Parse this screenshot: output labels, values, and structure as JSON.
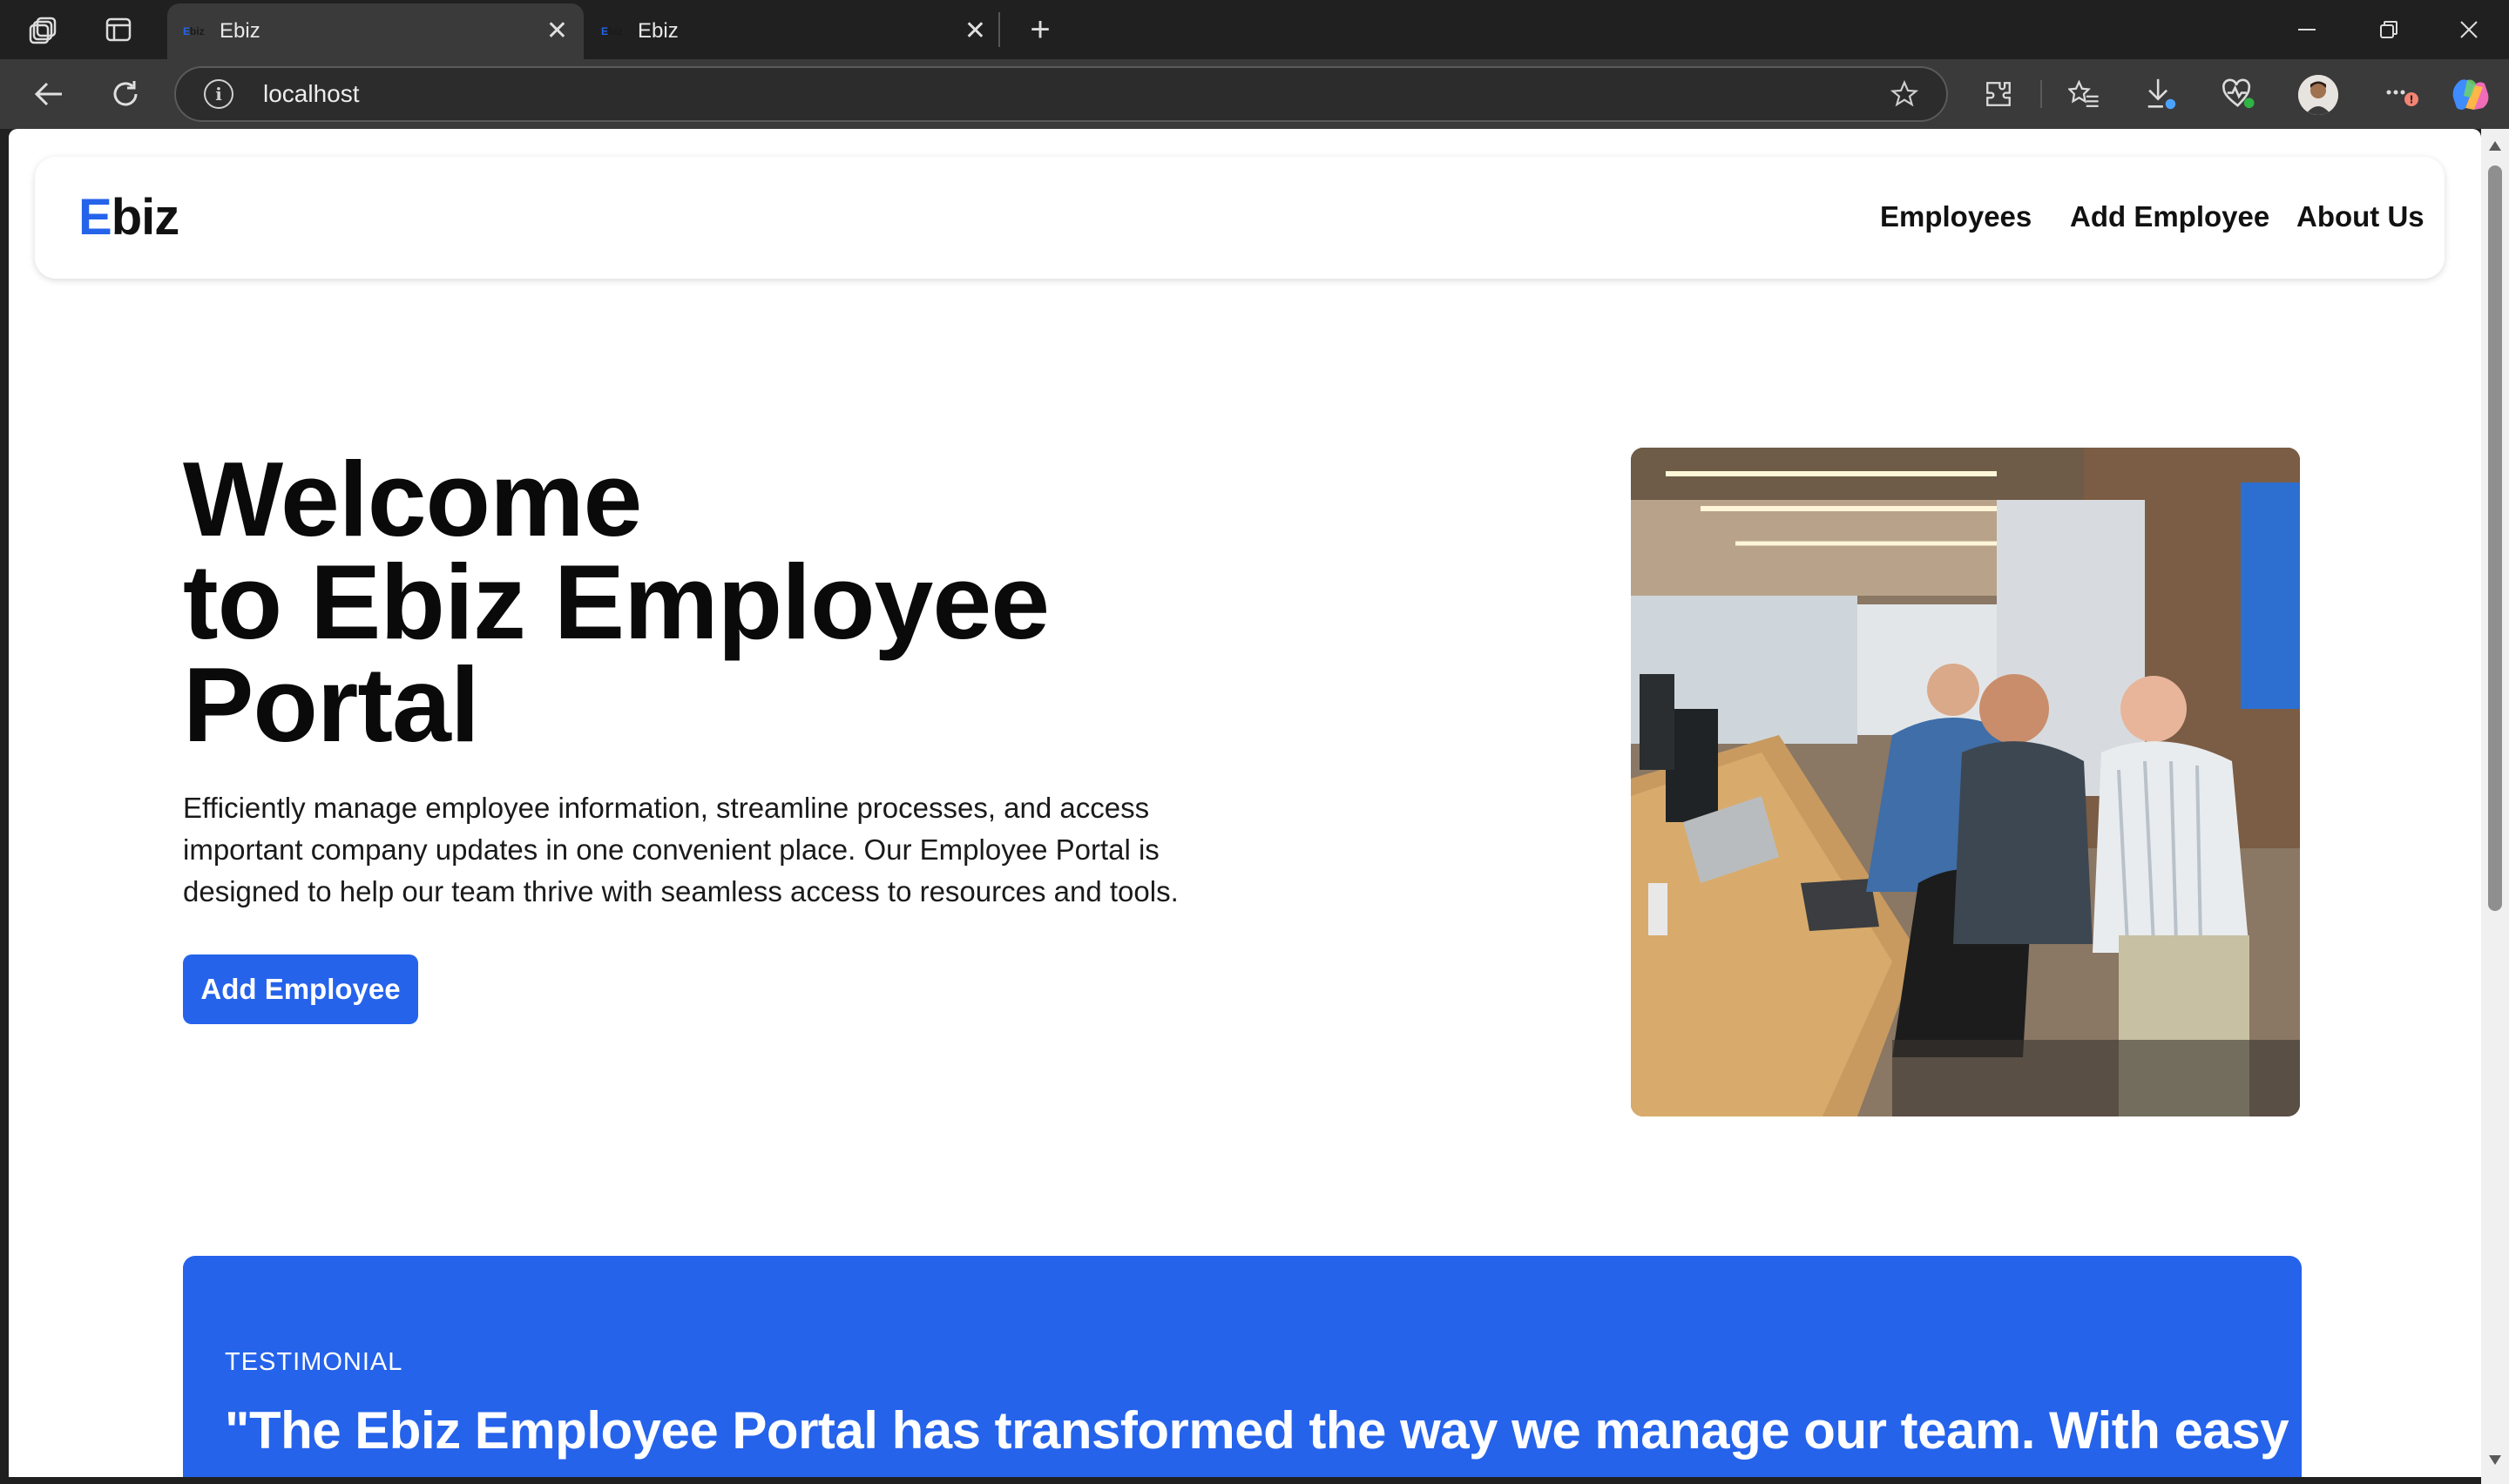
{
  "browser": {
    "tabs": [
      {
        "favicon": "Ebiz",
        "title": "Ebiz",
        "active": true
      },
      {
        "favicon": "Ebiz",
        "title": "Ebiz",
        "active": false
      }
    ],
    "address": "localhost"
  },
  "site": {
    "logo_first": "E",
    "logo_rest": "biz",
    "nav": [
      "Employees",
      "Add Employee",
      "About Us"
    ]
  },
  "hero": {
    "title_line1": "Welcome",
    "title_line2": "to Ebiz Employee",
    "title_line3": "Portal",
    "description": "Efficiently manage employee information, streamline processes, and access important company updates in one convenient place. Our Employee Portal is designed to help our team thrive with seamless access to resources and tools.",
    "button": "Add Employee",
    "image": "office-team-photo"
  },
  "testimonial": {
    "kicker": "TESTIMONIAL",
    "quote": "\"The Ebiz Employee Portal has transformed the way we manage our team. With easy"
  },
  "colors": {
    "brand": "#2563eb",
    "chrome": "#202020",
    "toolbar": "#3a3a3a"
  }
}
